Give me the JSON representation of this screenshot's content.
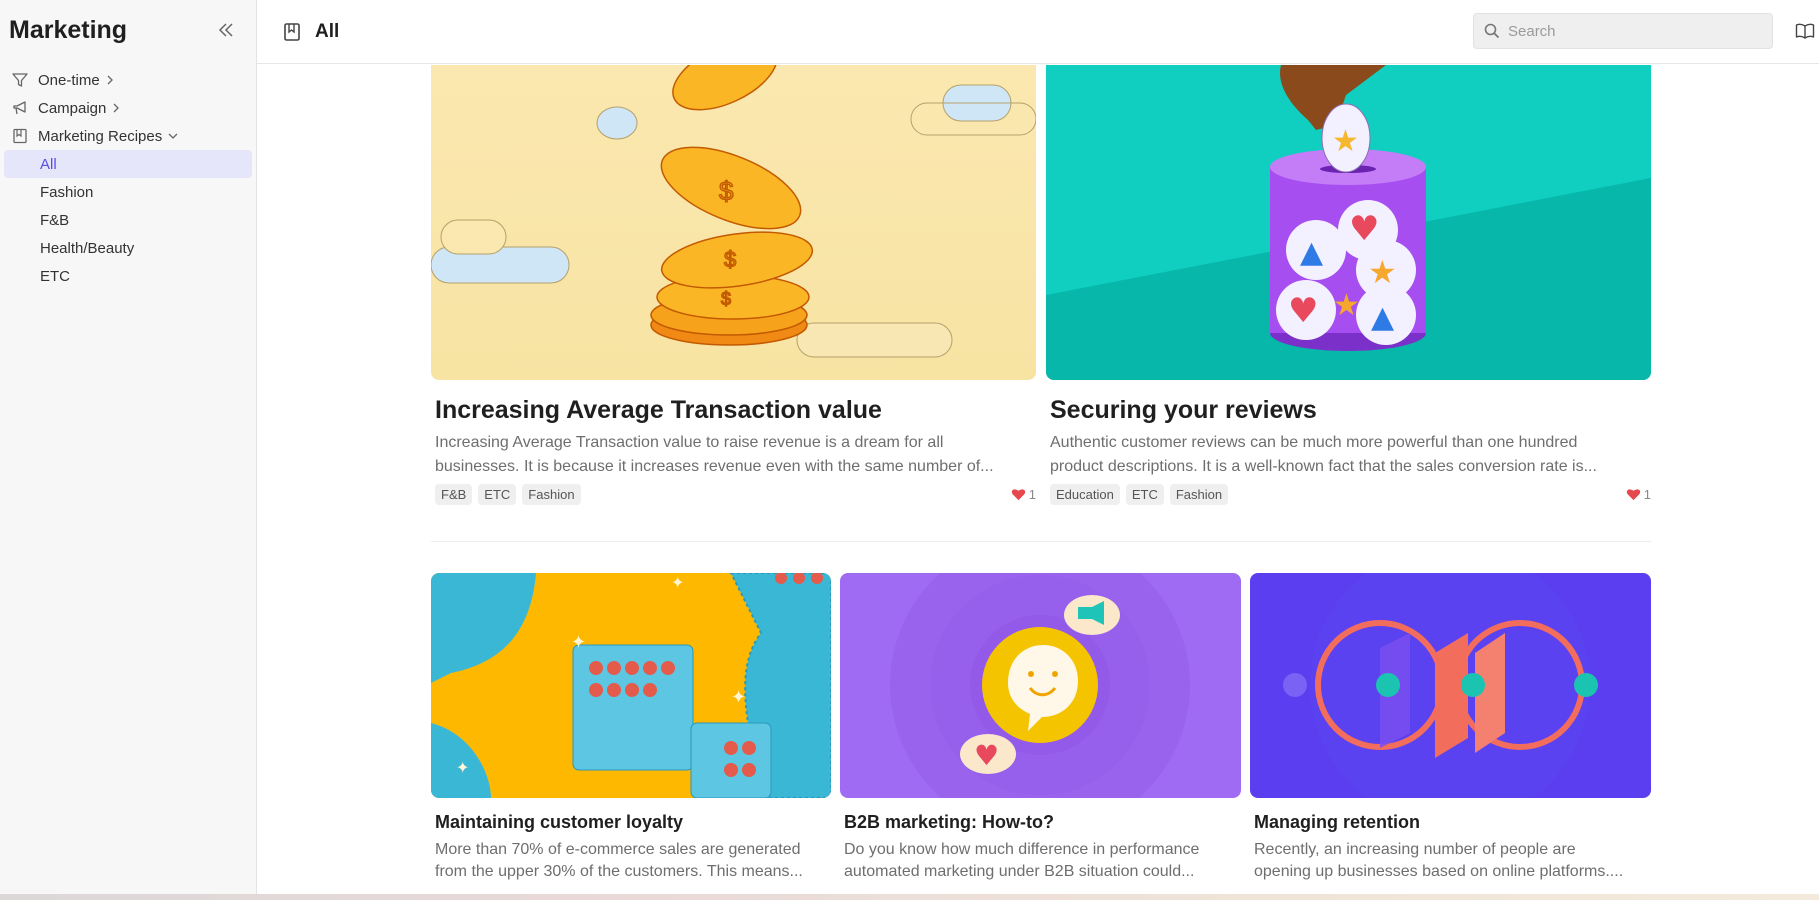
{
  "sidebar": {
    "title": "Marketing",
    "items": [
      {
        "label": "One-time",
        "icon": "filter-icon",
        "chevron": "right"
      },
      {
        "label": "Campaign",
        "icon": "megaphone-icon",
        "chevron": "right"
      },
      {
        "label": "Marketing Recipes",
        "icon": "book-icon",
        "chevron": "down"
      }
    ],
    "sub_items": [
      {
        "label": "All",
        "active": true
      },
      {
        "label": "Fashion",
        "active": false
      },
      {
        "label": "F&B",
        "active": false
      },
      {
        "label": "Health/Beauty",
        "active": false
      },
      {
        "label": "ETC",
        "active": false
      }
    ]
  },
  "header": {
    "title": "All",
    "search_placeholder": "Search"
  },
  "cards": [
    {
      "title": "Increasing Average Transaction value",
      "desc_line1": "Increasing Average Transaction value to raise revenue is a dream for all",
      "desc_line2": "businesses. It is because it increases revenue even with the same number of...",
      "tags": [
        "F&B",
        "ETC",
        "Fashion"
      ],
      "likes": "1",
      "image": "gold-coins-illustration"
    },
    {
      "title": "Securing your reviews",
      "desc_line1": "Authentic customer reviews can be much more powerful than one hundred",
      "desc_line2": "product descriptions. It is a well-known fact that the sales conversion rate is...",
      "tags": [
        "Education",
        "ETC",
        "Fashion"
      ],
      "likes": "1",
      "image": "review-jar-illustration"
    },
    {
      "title": "Maintaining customer loyalty",
      "desc_line1": "More than 70% of e-commerce sales are generated",
      "desc_line2": "from the upper 30% of the customers. This means...",
      "image": "stamp-cards-illustration"
    },
    {
      "title": "B2B marketing: How-to?",
      "desc_line1": "Do you know how much difference in performance",
      "desc_line2": "automated marketing under B2B situation could...",
      "image": "chat-bubble-illustration"
    },
    {
      "title": "Managing retention",
      "desc_line1": "Recently, an increasing number of people are",
      "desc_line2": "opening up businesses based on online platforms....",
      "image": "retention-loop-illustration"
    }
  ],
  "colors": {
    "accent": "#5b4de0",
    "active_bg": "#e6e6fb",
    "heart": "#e5484d",
    "card1_bg": "#f9e7b3",
    "card2_bg": "#06c8b9",
    "card3_bg": "#ffb800",
    "card4_bg": "#a06bf3",
    "card5_bg": "#5a3ef0"
  }
}
